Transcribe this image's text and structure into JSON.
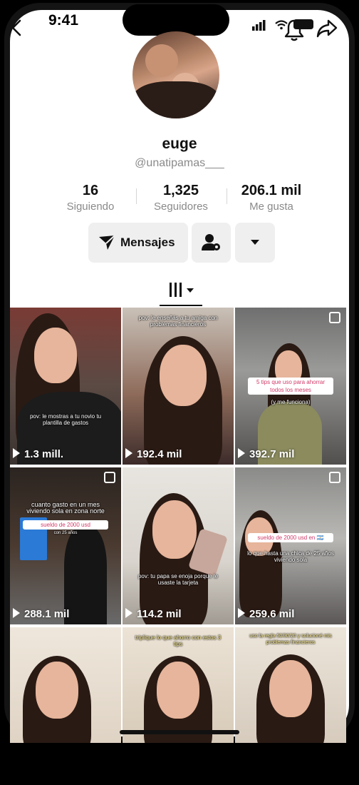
{
  "status_bar": {
    "time": "9:41"
  },
  "profile": {
    "name": "euge",
    "handle": "@unatipamas___",
    "stats": [
      {
        "value": "16",
        "label": "Siguiendo"
      },
      {
        "value": "1,325",
        "label": "Seguidores"
      },
      {
        "value": "206.1 mil",
        "label": "Me gusta"
      }
    ]
  },
  "actions": {
    "message_label": "Mensajes"
  },
  "videos": [
    {
      "views": "1.3 mill.",
      "caption": "pov: le mostras a tu novio tu plantilla de gastos",
      "pill": ""
    },
    {
      "views": "192.4 mil",
      "caption": "pov: le enseñás a tu amiga con problemas financieros",
      "pill": ""
    },
    {
      "views": "392.7 mil",
      "caption": "(y me funciona)",
      "pill": "5 tips que uso para ahorrar todos los meses"
    },
    {
      "views": "288.1 mil",
      "caption": "cuanto gasto en un mes viviendo sola en zona norte",
      "pill": "sueldo de 2000 usd",
      "sub": "con 25 años"
    },
    {
      "views": "114.2 mil",
      "caption": "pov: tu papa se enoja porque le usaste la tarjeta",
      "pill": ""
    },
    {
      "views": "259.6 mil",
      "caption": "lo que hasta una chica de 25 años viviendo sola",
      "pill": "sueldo de 2000 usd en 🇦🇷"
    },
    {
      "views": "",
      "caption": "",
      "pill": ""
    },
    {
      "views": "",
      "caption": "triplique lo que ahorro con estos 3 tips",
      "pill": ""
    },
    {
      "views": "",
      "caption": "uso la regla 50/30/20 y solucioné mis problemas financieros",
      "pill": ""
    }
  ],
  "colors": {
    "accent_pill_text": "#d13b6a",
    "button_bg": "#efefef",
    "muted_text": "#8a8a8a"
  }
}
